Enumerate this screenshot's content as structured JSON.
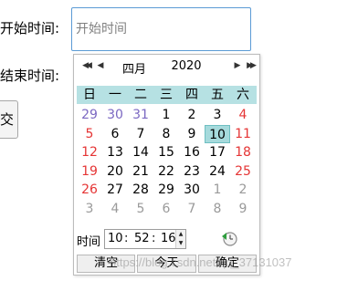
{
  "form": {
    "start_label": "开始时间:",
    "start_placeholder": "开始时间",
    "end_label": "结束时间:",
    "submit_label": "交"
  },
  "picker": {
    "month": "四月",
    "year": "2020",
    "weekdays": [
      "日",
      "一",
      "二",
      "三",
      "四",
      "五",
      "六"
    ],
    "weeks": [
      [
        {
          "d": "29",
          "t": "prev"
        },
        {
          "d": "30",
          "t": "prev"
        },
        {
          "d": "31",
          "t": "prev"
        },
        {
          "d": "1",
          "t": ""
        },
        {
          "d": "2",
          "t": ""
        },
        {
          "d": "3",
          "t": ""
        },
        {
          "d": "4",
          "t": "weekend"
        }
      ],
      [
        {
          "d": "5",
          "t": "weekend"
        },
        {
          "d": "6",
          "t": ""
        },
        {
          "d": "7",
          "t": ""
        },
        {
          "d": "8",
          "t": ""
        },
        {
          "d": "9",
          "t": ""
        },
        {
          "d": "10",
          "t": "selected"
        },
        {
          "d": "11",
          "t": "weekend"
        }
      ],
      [
        {
          "d": "12",
          "t": "weekend"
        },
        {
          "d": "13",
          "t": ""
        },
        {
          "d": "14",
          "t": ""
        },
        {
          "d": "15",
          "t": ""
        },
        {
          "d": "16",
          "t": ""
        },
        {
          "d": "17",
          "t": ""
        },
        {
          "d": "18",
          "t": "weekend"
        }
      ],
      [
        {
          "d": "19",
          "t": "weekend"
        },
        {
          "d": "20",
          "t": ""
        },
        {
          "d": "21",
          "t": ""
        },
        {
          "d": "22",
          "t": ""
        },
        {
          "d": "23",
          "t": ""
        },
        {
          "d": "24",
          "t": ""
        },
        {
          "d": "25",
          "t": "weekend"
        }
      ],
      [
        {
          "d": "26",
          "t": "weekend"
        },
        {
          "d": "27",
          "t": ""
        },
        {
          "d": "28",
          "t": ""
        },
        {
          "d": "29",
          "t": ""
        },
        {
          "d": "30",
          "t": ""
        },
        {
          "d": "1",
          "t": "other"
        },
        {
          "d": "2",
          "t": "other"
        }
      ],
      [
        {
          "d": "3",
          "t": "other"
        },
        {
          "d": "4",
          "t": "other"
        },
        {
          "d": "5",
          "t": "other"
        },
        {
          "d": "6",
          "t": "other"
        },
        {
          "d": "7",
          "t": "other"
        },
        {
          "d": "8",
          "t": "other"
        },
        {
          "d": "9",
          "t": "other"
        }
      ]
    ],
    "time_label": "时间",
    "hour": "10",
    "minute": "52",
    "second": "16",
    "time_separator": ":",
    "buttons": {
      "clear": "清空",
      "today": "今天",
      "ok": "确定"
    }
  },
  "watermark": "https://blog.csdn.net/qq_37131037",
  "colors": {
    "input_border": "#5b9bd5",
    "header_bg": "#b6e1e3",
    "selected_bg": "#a6dadc",
    "weekend": "#e53535",
    "prev_month": "#7b68c2",
    "other_month": "#9a9a9a"
  }
}
